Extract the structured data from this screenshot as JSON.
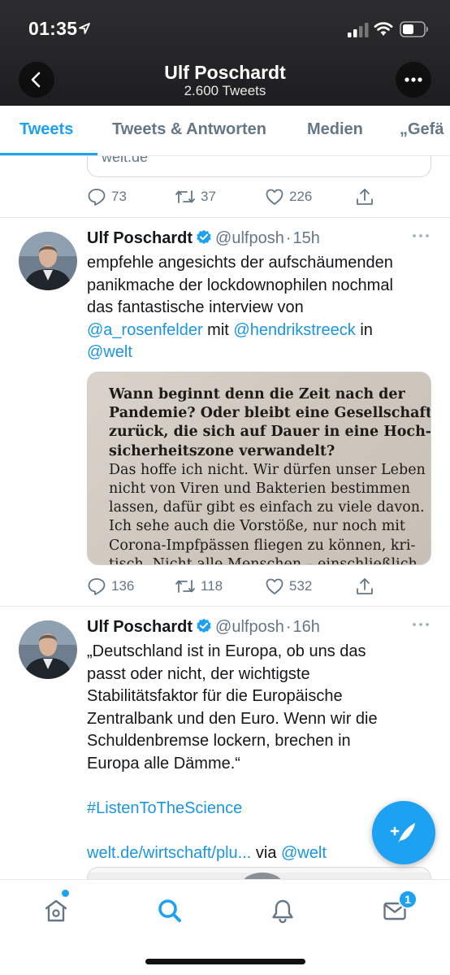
{
  "status_bar": {
    "time": "01:35"
  },
  "header": {
    "title": "Ulf Poschardt",
    "subtitle": "2.600 Tweets"
  },
  "tabs": [
    {
      "label": "Tweets",
      "active": true
    },
    {
      "label": "Tweets & Antworten",
      "active": false
    },
    {
      "label": "Medien",
      "active": false
    },
    {
      "label": "„Gefä",
      "active": false
    }
  ],
  "timeline": {
    "prev_tweet": {
      "link_domain": "welt.de",
      "replies": "73",
      "retweets": "37",
      "likes": "226"
    },
    "tweets": [
      {
        "name": "Ulf Poschardt",
        "handle": "@ulfposh",
        "dot": "·",
        "time": "15h",
        "body_lines": [
          [
            "empfehle angesichts der aufschäumenden"
          ],
          [
            "panikmache der lockdownophilen nochmal"
          ],
          [
            "das fantastische interview von"
          ],
          [
            "@a_rosenfelder",
            " mit ",
            "@hendrikstreeck",
            " in"
          ],
          [
            "@welt"
          ]
        ],
        "media_text": [
          "Wann beginnt denn die Zeit nach der",
          "Pandemie? Oder bleibt eine Gesellschaft",
          "zurück, die sich auf Dauer in eine Hoch-",
          "sicherheitszone verwandelt?",
          "Das hoffe ich nicht. Wir dürfen unser Leben",
          "nicht von Viren und Bakterien bestimmen",
          "lassen, dafür gibt es einfach zu viele davon.",
          "Ich sehe auch die Vorstöße, nur noch mit",
          "Corona-Impfpässen fliegen zu können, kri-",
          "tisch. Nicht alle Menschen – einschließlich"
        ],
        "replies": "136",
        "retweets": "118",
        "likes": "532"
      },
      {
        "name": "Ulf Poschardt",
        "handle": "@ulfposh",
        "dot": "·",
        "time": "16h",
        "body_lines": [
          "„Deutschland ist in Europa, ob uns das",
          "passt oder nicht, der wichtigste",
          "Stabilitätsfaktor für die Europäische",
          "Zentralbank und den Euro. Wenn wir die",
          "Schuldenbremse lockern, brechen in",
          "Europa alle Dämme.“"
        ],
        "hashtag": "#ListenToTheScience",
        "link": "welt.de/wirtschaft/plu...",
        "via": " via ",
        "via_handle": "@welt"
      }
    ]
  },
  "bottom_nav": {
    "items": [
      "home-icon",
      "search-icon",
      "notifications-icon",
      "messages-icon"
    ],
    "messages_badge": "1"
  },
  "colors": {
    "accent": "#1da1f2",
    "link": "#1b95e0",
    "text": "#14171a",
    "secondary": "#657786",
    "header_bg": "#242426"
  }
}
